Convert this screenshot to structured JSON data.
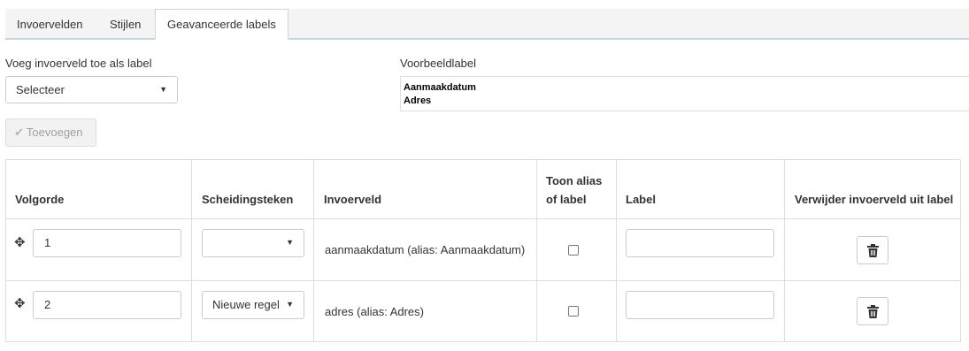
{
  "tabs": [
    {
      "label": "Invoervelden"
    },
    {
      "label": "Stijlen"
    },
    {
      "label": "Geavanceerde labels"
    }
  ],
  "add_field": {
    "label": "Voeg invoerveld toe als label",
    "select_value": "Selecteer",
    "button_label": "Toevoegen"
  },
  "preview": {
    "label": "Voorbeeldlabel",
    "lines": [
      "Aanmaakdatum",
      "Adres"
    ]
  },
  "table": {
    "headers": {
      "order": "Volgorde",
      "separator": "Scheidingsteken",
      "field": "Invoerveld",
      "alias_line1": "Toon alias",
      "alias_line2": "of label",
      "label": "Label",
      "remove": "Verwijder invoerveld uit label"
    },
    "rows": [
      {
        "order": "1",
        "separator": "",
        "field": "aanmaakdatum (alias: Aanmaakdatum)",
        "show_alias": false,
        "label": ""
      },
      {
        "order": "2",
        "separator": "Nieuwe regel",
        "field": "adres (alias: Adres)",
        "show_alias": false,
        "label": ""
      }
    ]
  },
  "icons": {
    "move": "move-icon",
    "trash": "trash-icon",
    "check": "check-icon",
    "caret": "caret-down-icon"
  }
}
